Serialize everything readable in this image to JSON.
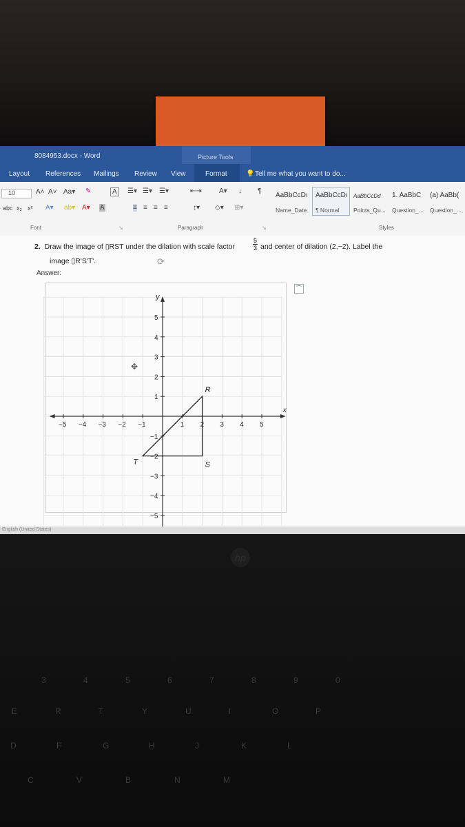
{
  "window": {
    "doc_title": "8084953.docx - Word",
    "context_tab": "Picture Tools"
  },
  "tabs": [
    "Layout",
    "References",
    "Mailings",
    "Review",
    "View",
    "Format"
  ],
  "tell_me": "Tell me what you want to do...",
  "ribbon": {
    "font_size": "10",
    "group_font": "Font",
    "group_paragraph": "Paragraph",
    "group_styles": "Styles",
    "styles": [
      {
        "sample": "AaBbCcDı",
        "name": "Name_Date"
      },
      {
        "sample": "AaBbCcDı",
        "name": "¶ Normal"
      },
      {
        "sample": "AaBbCcDd",
        "name": "Points_Qu..."
      },
      {
        "sample": "1. AaBbC",
        "name": "Question_..."
      },
      {
        "sample": "(a) AaBb(",
        "name": "Question_..."
      }
    ]
  },
  "question": {
    "number": "2.",
    "text_before": "Draw the image of ▯RST under the dilation with scale factor",
    "fraction_num": "5",
    "fraction_den": "3",
    "text_after": "and center of dilation (2,−2). Label the",
    "line2": "image ▯R'S'T'.",
    "answer_label": "Answer:"
  },
  "graph": {
    "x_label": "x",
    "y_label": "y",
    "x_ticks": [
      "−5",
      "−4",
      "−3",
      "−2",
      "−1",
      "1",
      "2",
      "3",
      "4",
      "5"
    ],
    "y_ticks": [
      "5",
      "4",
      "3",
      "2",
      "1",
      "−1",
      "−2",
      "−3",
      "−4",
      "−5"
    ],
    "points": [
      {
        "label": "R",
        "x": 2,
        "y": 1
      },
      {
        "label": "S",
        "x": 2,
        "y": -2
      },
      {
        "label": "T",
        "x": -1,
        "y": -2
      }
    ]
  },
  "status": {
    "language": "English (United States)"
  },
  "keyboard": {
    "row1": [
      "3",
      "4",
      "5",
      "6",
      "7",
      "8",
      "9",
      "0"
    ],
    "row2": [
      "E",
      "R",
      "T",
      "Y",
      "U",
      "I",
      "O",
      "P"
    ],
    "row3": [
      "D",
      "F",
      "G",
      "H",
      "J",
      "K",
      "L"
    ],
    "row4": [
      "C",
      "V",
      "B",
      "N",
      "M"
    ]
  }
}
